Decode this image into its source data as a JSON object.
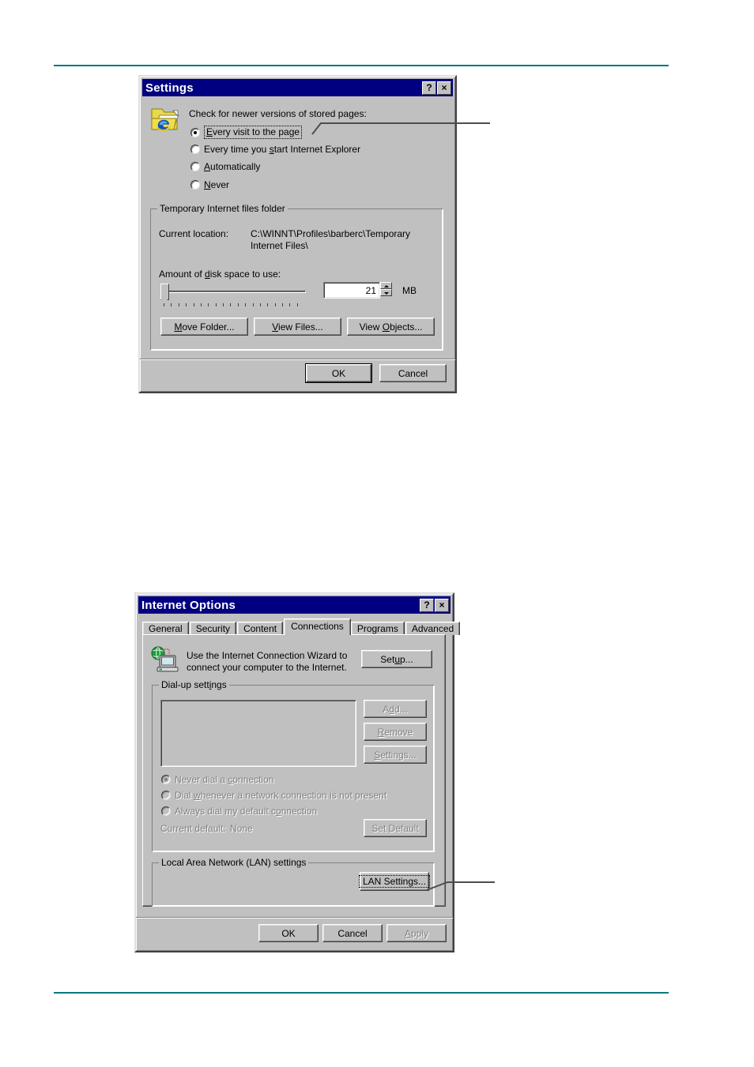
{
  "page": {
    "rule_color": "#007880"
  },
  "settings_dialog": {
    "title": "Settings",
    "help_button": "?",
    "close_button": "×",
    "check_label": "Check for newer versions of stored pages:",
    "icon_name": "ie-temporary-files-folder-icon",
    "options": [
      {
        "label": "Every visit to the page",
        "selected": true,
        "focused": true
      },
      {
        "label": "Every time you start Internet Explorer",
        "selected": false,
        "focused": false
      },
      {
        "label": "Automatically",
        "selected": false,
        "focused": false
      },
      {
        "label": "Never",
        "selected": false,
        "focused": false
      }
    ],
    "temp_group": {
      "legend": "Temporary Internet files folder",
      "current_location_label": "Current location:",
      "current_location_value_line1": "C:\\WINNT\\Profiles\\barberc\\Temporary",
      "current_location_value_line2": "Internet Files\\",
      "disk_space_label": "Amount of disk space to use:",
      "disk_space_value": "21",
      "disk_space_unit": "MB",
      "slider_ticks": 19,
      "buttons": [
        {
          "label": "Move Folder...",
          "disabled": false
        },
        {
          "label": "View Files...",
          "disabled": false
        },
        {
          "label": "View Objects...",
          "disabled": false
        }
      ]
    },
    "footer_buttons": [
      {
        "label": "OK",
        "default": true,
        "disabled": false
      },
      {
        "label": "Cancel",
        "default": false,
        "disabled": false
      }
    ],
    "callout_target": "Every visit to the page"
  },
  "internet_options_dialog": {
    "title": "Internet Options",
    "help_button": "?",
    "close_button": "×",
    "tabs": [
      {
        "label": "General",
        "active": false
      },
      {
        "label": "Security",
        "active": false
      },
      {
        "label": "Content",
        "active": false
      },
      {
        "label": "Connections",
        "active": true
      },
      {
        "label": "Programs",
        "active": false
      },
      {
        "label": "Advanced",
        "active": false
      }
    ],
    "wizard": {
      "icon_name": "globe-computer-icon",
      "text_line1": "Use the Internet Connection Wizard to",
      "text_line2": "connect your computer to the Internet.",
      "setup_button": "Setup..."
    },
    "dialup_group": {
      "legend": "Dial-up settings",
      "list_items": [],
      "buttons": [
        {
          "label": "Add...",
          "disabled": true
        },
        {
          "label": "Remove",
          "disabled": true
        },
        {
          "label": "Settings...",
          "disabled": true
        }
      ],
      "radios": [
        {
          "label": "Never dial a connection",
          "selected": true,
          "disabled": true
        },
        {
          "label": "Dial whenever a network connection is not present",
          "selected": false,
          "disabled": true
        },
        {
          "label": "Always dial my default connection",
          "selected": false,
          "disabled": true
        }
      ],
      "current_default_label": "Current default:",
      "current_default_value": "None",
      "set_default_button": {
        "label": "Set Default",
        "disabled": true
      }
    },
    "lan_group": {
      "legend": "Local Area Network (LAN) settings",
      "lan_settings_button": {
        "label": "LAN Settings...",
        "focused": true
      }
    },
    "footer_buttons": [
      {
        "label": "OK",
        "default": false,
        "disabled": false
      },
      {
        "label": "Cancel",
        "default": false,
        "disabled": false
      },
      {
        "label": "Apply",
        "default": false,
        "disabled": true
      }
    ],
    "callout_target": "LAN Settings..."
  }
}
